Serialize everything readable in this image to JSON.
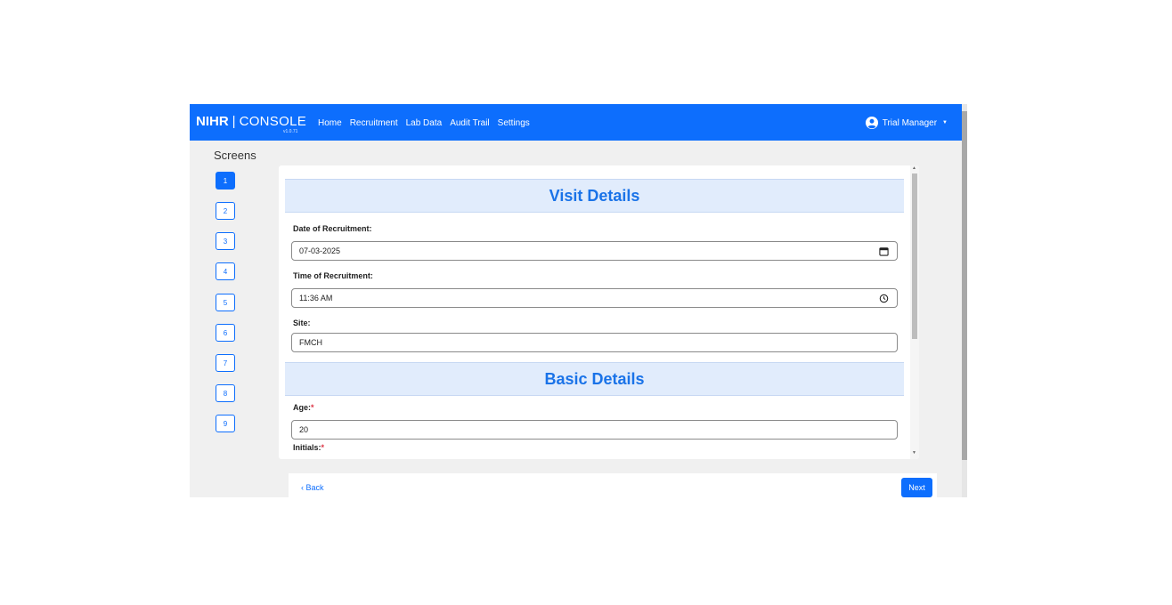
{
  "navbar": {
    "brand_bold": "NIHR",
    "brand_sep": "|",
    "brand_name": "CONSOLE",
    "version": "v1.0.71",
    "links": [
      "Home",
      "Recruitment",
      "Lab Data",
      "Audit Trail",
      "Settings"
    ],
    "user": "Trial Manager",
    "user_icon": "user-circle-icon",
    "background": "#0d6efd"
  },
  "sidebar": {
    "title": "Screens",
    "screens": [
      "1",
      "2",
      "3",
      "4",
      "5",
      "6",
      "7",
      "8",
      "9"
    ],
    "active": "1"
  },
  "form": {
    "visit_title": "Visit Details",
    "date_label": "Date of Recruitment:",
    "date_value": "07-03-2025",
    "time_label": "Time of Recruitment:",
    "time_value": "11:36 AM",
    "site_label": "Site:",
    "site_value": "FMCH",
    "basic_title": "Basic Details",
    "age_label": "Age:",
    "age_required": "*",
    "age_value": "20",
    "initials_label": "Initials:",
    "initials_required": "*"
  },
  "footer": {
    "back_label": "Back",
    "next_label": "Next"
  },
  "colors": {
    "accent": "#0d6efd",
    "section_bg": "#e1ecfc",
    "section_text": "#1a73e8",
    "required": "#dc3545"
  }
}
